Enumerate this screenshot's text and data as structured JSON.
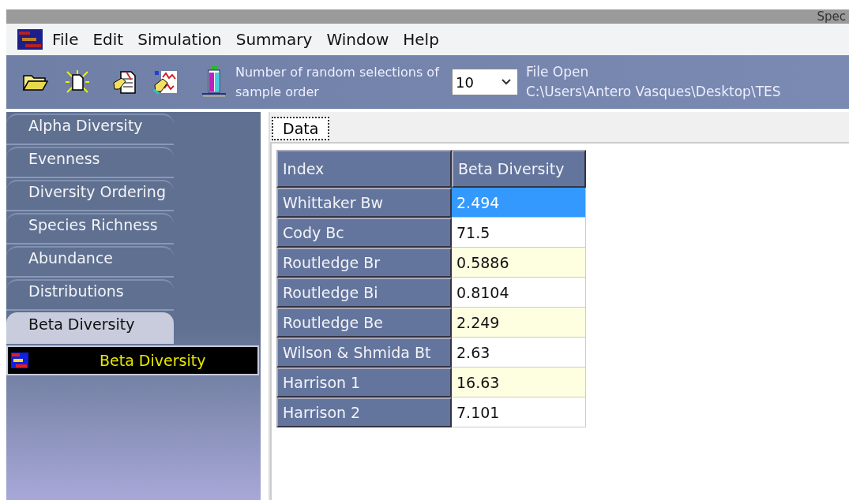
{
  "window": {
    "title": "Spec"
  },
  "menu": [
    "File",
    "Edit",
    "Simulation",
    "Summary",
    "Window",
    "Help"
  ],
  "toolbar": {
    "selections_label": "Number of random selections of sample order",
    "selections": {
      "value": "10"
    },
    "file_status": "File Open",
    "file_path": "C:\\Users\\Antero Vasques\\Desktop\\TES"
  },
  "sidebar": {
    "tabs": [
      {
        "label": "Alpha Diversity",
        "selected": false
      },
      {
        "label": "Evenness",
        "selected": false
      },
      {
        "label": "Diversity Ordering",
        "selected": false
      },
      {
        "label": "Species Richness",
        "selected": false
      },
      {
        "label": "Abundance",
        "selected": false
      },
      {
        "label": "Distributions",
        "selected": false
      },
      {
        "label": "Beta Diversity",
        "selected": true
      }
    ],
    "items": [
      {
        "label": "Beta Diversity",
        "selected": true
      }
    ]
  },
  "content_tabs": [
    {
      "label": "Data",
      "selected": true
    }
  ],
  "table": {
    "columns": [
      "Index",
      "Beta Diversity"
    ],
    "rows": [
      {
        "index": "Whittaker Bw",
        "value": "2.494",
        "selected": true
      },
      {
        "index": "Cody Bc",
        "value": "71.5",
        "selected": false
      },
      {
        "index": "Routledge Br",
        "value": "0.5886",
        "selected": false
      },
      {
        "index": "Routledge Bi",
        "value": "0.8104",
        "selected": false
      },
      {
        "index": "Routledge Be",
        "value": "2.249",
        "selected": false
      },
      {
        "index": "Wilson & Shmida Bt",
        "value": "2.63",
        "selected": false
      },
      {
        "index": "Harrison 1",
        "value": "16.63",
        "selected": false
      },
      {
        "index": "Harrison 2",
        "value": "7.101",
        "selected": false
      }
    ]
  }
}
